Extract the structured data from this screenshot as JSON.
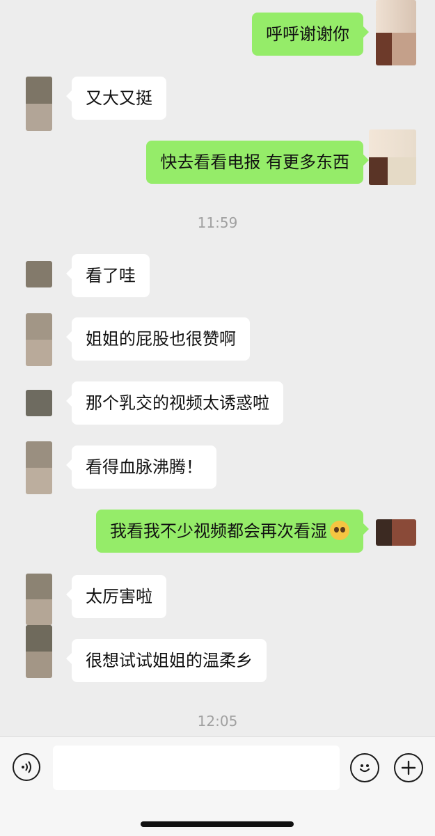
{
  "messages": [
    {
      "side": "out",
      "text": "呼呼谢谢你"
    },
    {
      "side": "in",
      "text": "又大又挺"
    },
    {
      "side": "out",
      "text": "快去看看电报 有更多东西"
    },
    {
      "side": "time",
      "text": "11:59"
    },
    {
      "side": "in",
      "text": "看了哇"
    },
    {
      "side": "in",
      "text": "姐姐的屁股也很赞啊"
    },
    {
      "side": "in",
      "text": "那个乳交的视频太诱惑啦"
    },
    {
      "side": "in",
      "text": "看得血脉沸腾！"
    },
    {
      "side": "out",
      "text": "我看我不少视频都会再次看湿",
      "emoji": "pleading-face-emoji"
    },
    {
      "side": "in",
      "text": "太厉害啦"
    },
    {
      "side": "in",
      "text": "很想试试姐姐的温柔乡"
    },
    {
      "side": "time",
      "text": "12:05"
    }
  ],
  "input_bar": {
    "voice_icon": "voice-icon",
    "input_value": "",
    "emoji_icon": "emoji-icon",
    "add_icon": "plus-icon"
  },
  "colors": {
    "background": "#ededed",
    "bubble_in": "#ffffff",
    "bubble_out": "#95ec69",
    "time_text": "#a0a0a0"
  }
}
